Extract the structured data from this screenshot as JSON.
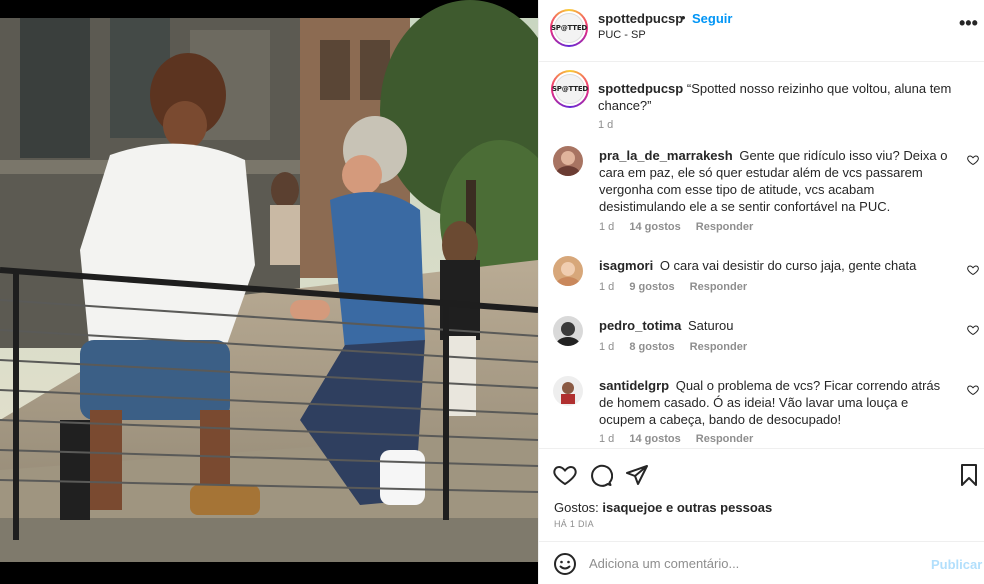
{
  "post": {
    "username": "spottedpucsp",
    "follow_label": "Seguir",
    "separator": "•",
    "location": "PUC - SP",
    "more_icon": "more-horizontal-icon",
    "logo_text": "SP@TTED",
    "caption": {
      "username": "spottedpucsp",
      "text": "“Spotted nosso reizinho que voltou, aluna tem chance?”",
      "time": "1 d"
    }
  },
  "comments": [
    {
      "username": "pra_la_de_marrakesh",
      "text": "Gente que ridículo isso viu? Deixa o cara em paz, ele só quer estudar além de vcs passarem vergonha com esse tipo de atitude, vcs acabam desistimulando ele a se sentir confortável na PUC.",
      "time": "1 d",
      "likes": "14 gostos",
      "reply": "Responder"
    },
    {
      "username": "isagmori",
      "text": "O cara vai desistir do curso jaja, gente chata",
      "time": "1 d",
      "likes": "9 gostos",
      "reply": "Responder"
    },
    {
      "username": "pedro_totima",
      "text": "Saturou",
      "time": "1 d",
      "likes": "8 gostos",
      "reply": "Responder"
    },
    {
      "username": "santidelgrp",
      "text": "Qual o problema de vcs? Ficar correndo atrás de homem casado. Ó as ideia! Vão lavar uma louça e ocupem a cabeça, bando de desocupado!",
      "time": "1 d",
      "likes": "14 gostos",
      "reply": "Responder"
    }
  ],
  "actions": {
    "like_icon": "heart-icon",
    "comment_icon": "comment-icon",
    "share_icon": "share-icon",
    "save_icon": "bookmark-icon",
    "likes_prefix": "Gostos:",
    "likes_names": "isaquejoe e outras pessoas",
    "date": "HÁ 1 DIA"
  },
  "add_comment": {
    "placeholder": "Adiciona um comentário...",
    "publish_label": "Publicar",
    "emoji_icon": "emoji-icon"
  },
  "colors": {
    "accent": "#0095f6",
    "publish_disabled": "#b2dffc",
    "muted": "#8e8e8e"
  }
}
